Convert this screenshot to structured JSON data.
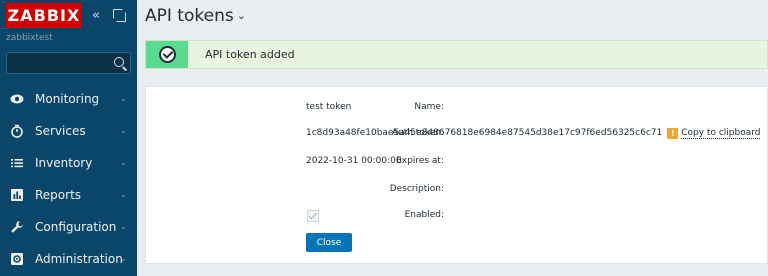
{
  "sidebar": {
    "logo": "ZABBIX",
    "server_name": "zabbixtest",
    "search": {
      "value": "",
      "placeholder": ""
    },
    "items": [
      {
        "label": "Monitoring",
        "icon": "eye-icon"
      },
      {
        "label": "Services",
        "icon": "clock-icon"
      },
      {
        "label": "Inventory",
        "icon": "list-icon"
      },
      {
        "label": "Reports",
        "icon": "bar-chart-icon"
      },
      {
        "label": "Configuration",
        "icon": "wrench-icon"
      },
      {
        "label": "Administration",
        "icon": "gear-icon"
      }
    ]
  },
  "header": {
    "title": "API tokens"
  },
  "message": {
    "text": "API token added"
  },
  "form": {
    "name_label": "Name:",
    "name_value": "test token",
    "auth_label": "Auth token:",
    "auth_value": "1c8d93a48fe10bae5a45e848676818e6984e87545d38e17c97f6ed56325c6c71",
    "copy_label": "Copy to clipboard",
    "expires_label": "Expires at:",
    "expires_value": "2022-10-31 00:00:00",
    "description_label": "Description:",
    "description_value": "",
    "enabled_label": "Enabled:",
    "enabled": true,
    "close_label": "Close"
  },
  "colors": {
    "sidebar_bg": "#0a466a",
    "logo_bg": "#d40000",
    "success_strip": "#59db8f",
    "button_bg": "#0275b8",
    "warning_icon": "#f4a721"
  }
}
